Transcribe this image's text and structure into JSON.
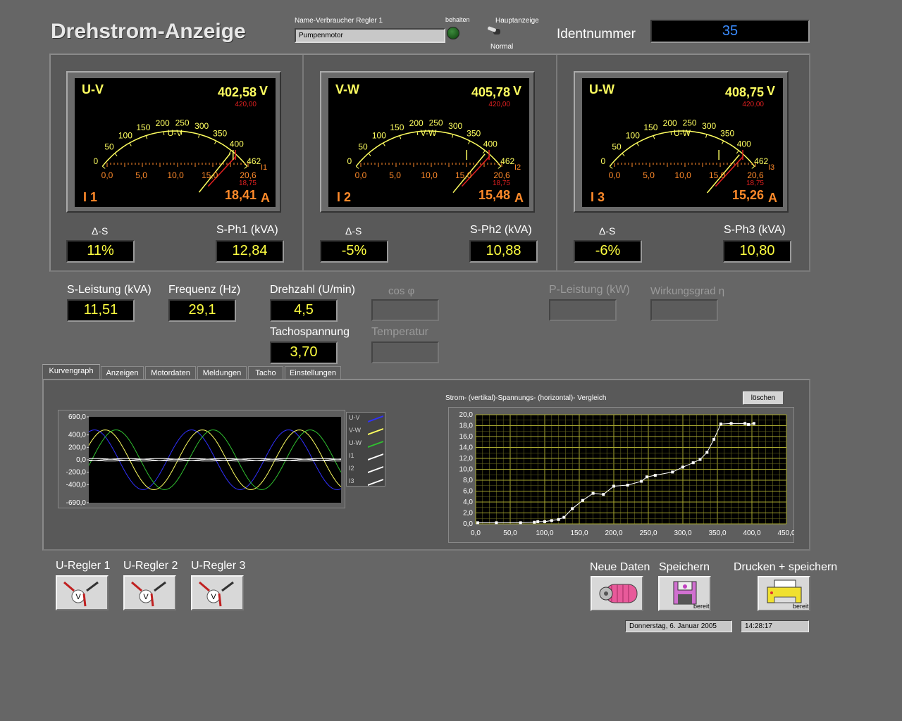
{
  "header": {
    "title": "Drehstrom-Anzeige",
    "consumer_label": "Name-Verbraucher Regler 1",
    "consumer_value": "Pumpenmotor",
    "keep_label": "behalten",
    "main_display_label": "Hauptanzeige",
    "normal_label": "Normal",
    "ident_label": "Identnummer",
    "ident_value": "35"
  },
  "meters": [
    {
      "phase": "U-V",
      "voltage": "402,58",
      "volt_unit": "V",
      "max_v": "420,00",
      "current_label": "I 1",
      "current": "18,41",
      "amp_unit": "A",
      "max_a": "18,75",
      "i_tag": "I1",
      "delta_label": "Δ-S",
      "delta": "11%",
      "s_label": "S-Ph1 (kVA)",
      "s_value": "12,84",
      "needle_v": 402.58,
      "needle_a": 18.41
    },
    {
      "phase": "V-W",
      "voltage": "405,78",
      "volt_unit": "V",
      "max_v": "420,00",
      "current_label": "I 2",
      "current": "15,48",
      "amp_unit": "A",
      "max_a": "18,75",
      "i_tag": "I2",
      "delta_label": "Δ-S",
      "delta": "-5%",
      "s_label": "S-Ph2 (kVA)",
      "s_value": "10,88",
      "needle_v": 405.78,
      "needle_a": 15.48
    },
    {
      "phase": "U-W",
      "voltage": "408,75",
      "volt_unit": "V",
      "max_v": "420,00",
      "current_label": "I 3",
      "current": "15,26",
      "amp_unit": "A",
      "max_a": "18,75",
      "i_tag": "I3",
      "delta_label": "Δ-S",
      "delta": "-6%",
      "s_label": "S-Ph3 (kVA)",
      "s_value": "10,80",
      "needle_v": 408.75,
      "needle_a": 15.26
    }
  ],
  "volt_scale": [
    "0",
    "50",
    "100",
    "150",
    "200",
    "250",
    "300",
    "350",
    "400",
    "462"
  ],
  "amp_scale": [
    "0,0",
    "5,0",
    "10,0",
    "15,0",
    "20,6"
  ],
  "readouts": {
    "s_power_label": "S-Leistung (kVA)",
    "s_power": "11,51",
    "freq_label": "Frequenz (Hz)",
    "freq": "29,1",
    "rpm_label": "Drehzahl (U/min)",
    "rpm": "4,5",
    "tacho_label": "Tachospannung",
    "tacho": "3,70",
    "cos_label": "cos φ",
    "temp_label": "Temperatur",
    "p_label": "P-Leistung (kW)",
    "eff_label": "Wirkungsgrad η"
  },
  "tabs": [
    "Kurvengraph",
    "Anzeigen",
    "Motordaten",
    "Meldungen",
    "Tacho",
    "Einstellungen"
  ],
  "wave_legend": [
    "U-V",
    "V-W",
    "U-W",
    "I1",
    "I2",
    "I3"
  ],
  "wave_colors": [
    "#3030ff",
    "#ffff60",
    "#30c030",
    "#ffffff",
    "#ffffff",
    "#ffffff"
  ],
  "xy_title": "Strom- (vertikal)-Spannungs- (horizontal)- Vergleich",
  "clear_button": "löschen",
  "chart_data": [
    {
      "type": "line",
      "y_ticks": [
        "690,0",
        "400,0",
        "200,0",
        "0,0",
        "-200,0",
        "-400,0",
        "-690,0"
      ],
      "ylim": [
        -690,
        690
      ],
      "series": [
        {
          "name": "U-V",
          "amplitude": 480,
          "phase_deg": 0
        },
        {
          "name": "V-W",
          "amplitude": 480,
          "phase_deg": -40
        },
        {
          "name": "U-W",
          "amplitude": 480,
          "phase_deg": -80
        },
        {
          "name": "I1",
          "amplitude": 20,
          "phase_deg": 0
        },
        {
          "name": "I2",
          "amplitude": 20,
          "phase_deg": -120
        },
        {
          "name": "I3",
          "amplitude": 20,
          "phase_deg": -240
        }
      ],
      "cycles": 2.6
    },
    {
      "type": "scatter",
      "xlim": [
        0,
        450
      ],
      "ylim": [
        0,
        20
      ],
      "x_ticks": [
        "0,0",
        "50,0",
        "100,0",
        "150,0",
        "200,0",
        "250,0",
        "300,0",
        "350,0",
        "400,0",
        "450,0"
      ],
      "y_ticks": [
        "0,0",
        "2,0",
        "4,0",
        "6,0",
        "8,0",
        "10,0",
        "12,0",
        "14,0",
        "16,0",
        "18,0",
        "20,0"
      ],
      "x": [
        3,
        30,
        65,
        85,
        90,
        100,
        110,
        120,
        128,
        140,
        155,
        170,
        185,
        200,
        220,
        240,
        248,
        260,
        285,
        300,
        315,
        325,
        335,
        345,
        355,
        370,
        390,
        395,
        403
      ],
      "y": [
        0.2,
        0.2,
        0.2,
        0.3,
        0.4,
        0.4,
        0.6,
        0.8,
        1.2,
        2.8,
        4.3,
        5.6,
        5.4,
        6.9,
        7.1,
        7.8,
        8.6,
        8.9,
        9.5,
        10.4,
        11.2,
        11.8,
        13.1,
        15.5,
        18.3,
        18.4,
        18.4,
        18.2,
        18.4
      ]
    }
  ],
  "controllers": [
    "U-Regler 1",
    "U-Regler 2",
    "U-Regler 3"
  ],
  "actions": {
    "new_data": "Neue Daten",
    "save": "Speichern",
    "print_save": "Drucken + speichern",
    "ready": "bereit"
  },
  "status": {
    "date": "Donnerstag, 6. Januar 2005",
    "time": "14:28:17"
  }
}
